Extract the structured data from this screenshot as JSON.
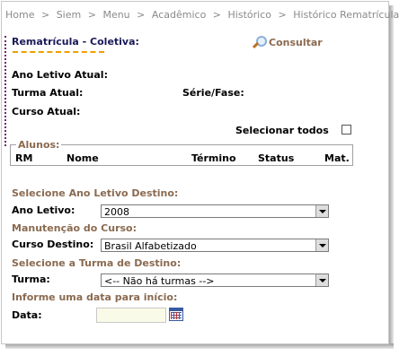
{
  "breadcrumb": [
    "Home",
    ">",
    "Siem",
    ">",
    "Menu",
    ">",
    "Acadêmico",
    ">",
    "Histórico",
    ">",
    "Histórico Rematrícula"
  ],
  "title": "Rematrícula - Coletiva:",
  "consultar_label": "Consultar",
  "labels": {
    "ano_letivo_atual": "Ano Letivo Atual:",
    "turma_atual": "Turma Atual:",
    "serie_fase": "Série/Fase:",
    "curso_atual": "Curso Atual:",
    "selecionar_todos": "Selecionar todos"
  },
  "alunos": {
    "legend": "Alunos:",
    "columns": [
      "RM",
      "Nome",
      "Término",
      "Status",
      "Mat."
    ]
  },
  "destino": {
    "sec_ano": "Selecione Ano Letivo Destino:",
    "ano_label": "Ano Letivo:",
    "ano_value": "2008",
    "sec_curso": "Manutenção do Curso:",
    "curso_label": "Curso Destino:",
    "curso_value": "Brasil Alfabetizado",
    "sec_turma": "Selecione a Turma de Destino:",
    "turma_label": "Turma:",
    "turma_value": "<-- Não há turmas -->",
    "sec_data": "Informe uma data para início:",
    "data_label": "Data:",
    "data_value": ""
  },
  "colors": {
    "accent": "#8a6a50",
    "title": "#1a1a5a",
    "underline": "#f0a000",
    "breadcrumb": "#8a8a8a"
  }
}
